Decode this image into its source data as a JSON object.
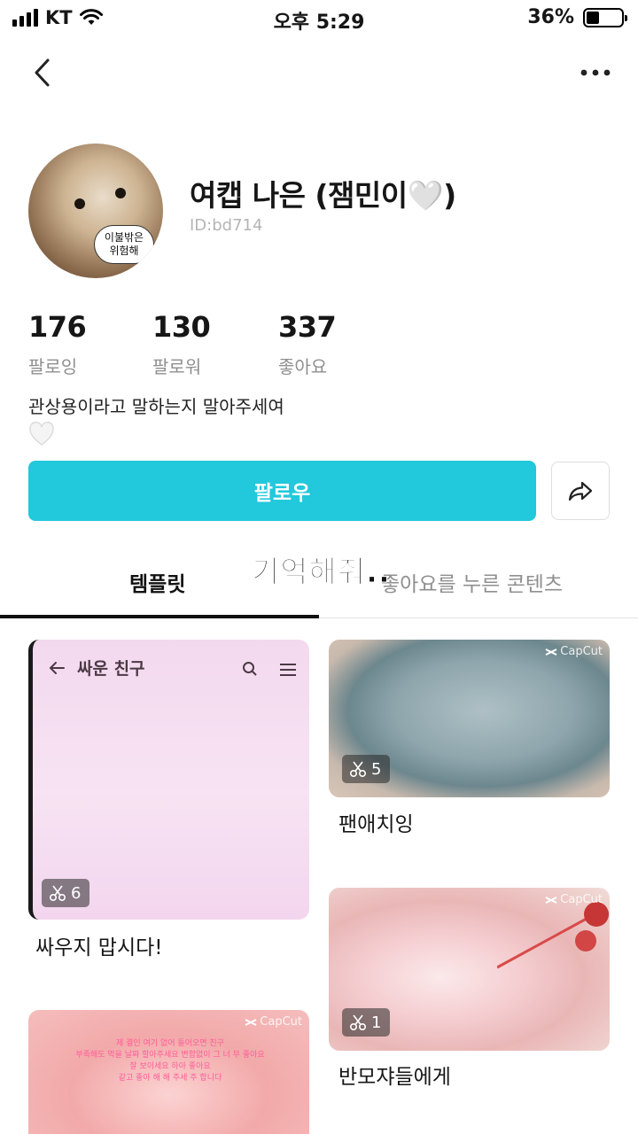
{
  "status_bar": {
    "carrier": "KT",
    "time": "오후 5:29",
    "battery_percent": "36%",
    "battery_level": 0.36
  },
  "profile": {
    "name": "여캡 나은 (잼민이🤍)",
    "id": "ID:bd714",
    "avatar_text": "이불밖은\n위험해",
    "bio": "관상용이라고 말하는지 말아주세여",
    "bio_emoji": "🤍"
  },
  "stats": [
    {
      "value": "176",
      "label": "팔로잉"
    },
    {
      "value": "130",
      "label": "팔로워"
    },
    {
      "value": "337",
      "label": "좋아요"
    }
  ],
  "actions": {
    "follow_label": "팔로우"
  },
  "overlay_text": "기억해줘..",
  "tabs": [
    {
      "label": "템플릿",
      "active": true
    },
    {
      "label": "좋아요를 누른 콘텐츠",
      "active": false
    }
  ],
  "templates": [
    {
      "title": "싸우지 맙시다!",
      "clips": "6",
      "thumb_header": "싸운 친구"
    },
    {
      "title": "팬애치잉",
      "clips": "5",
      "watermark": "CapCut"
    },
    {
      "title": "반모쟈들에게",
      "clips": "1",
      "watermark": "CapCut"
    },
    {
      "title": "",
      "watermark": "CapCut",
      "thumb_text": "제 결인 여기 없어 들어오면 친구\n부족해도 먹을 날짜 할아주세요 변함없이 그 너 무 좋아요\n잘 보이세요 하아 좋아요\n같고 좋아 해 해 주세 주 합니다"
    }
  ],
  "icons": {
    "back": "chevron-left-icon",
    "more": "more-horizontal-icon",
    "share": "share-arrow-icon",
    "clip": "scissors-icon"
  },
  "colors": {
    "accent": "#22c8dc",
    "text": "#161616",
    "muted": "#8f8f8f"
  }
}
